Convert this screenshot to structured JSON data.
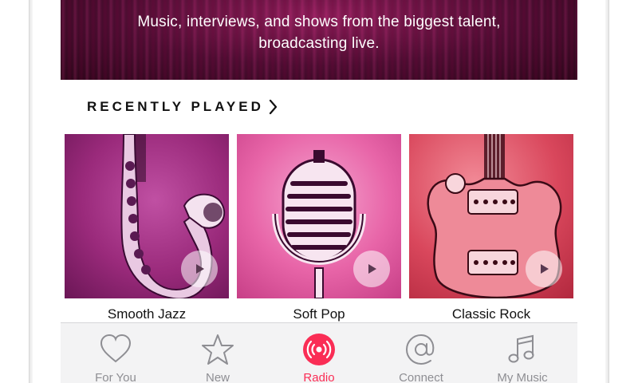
{
  "banner": {
    "line1": "Music, interviews, and shows from the biggest talent,",
    "line2": "broadcasting live."
  },
  "recently_played": {
    "title": "RECENTLY PLAYED",
    "chevron_icon": "chevron-right-icon",
    "stations": [
      {
        "label": "Smooth Jazz",
        "art_icon": "saxophone-icon",
        "color": "#a2357f"
      },
      {
        "label": "Soft Pop",
        "art_icon": "microphone-icon",
        "color": "#e35a9f"
      },
      {
        "label": "Classic Rock",
        "art_icon": "guitar-icon",
        "color": "#d73e54"
      }
    ],
    "play_icon": "play-icon"
  },
  "tabbar": {
    "active": "Radio",
    "active_color": "#fa2d55",
    "inactive_color": "#8e8e93",
    "tabs": [
      {
        "label": "For You",
        "icon": "heart-icon"
      },
      {
        "label": "New",
        "icon": "star-icon"
      },
      {
        "label": "Radio",
        "icon": "radio-broadcast-icon"
      },
      {
        "label": "Connect",
        "icon": "at-sign-icon"
      },
      {
        "label": "My Music",
        "icon": "music-note-icon"
      }
    ]
  }
}
